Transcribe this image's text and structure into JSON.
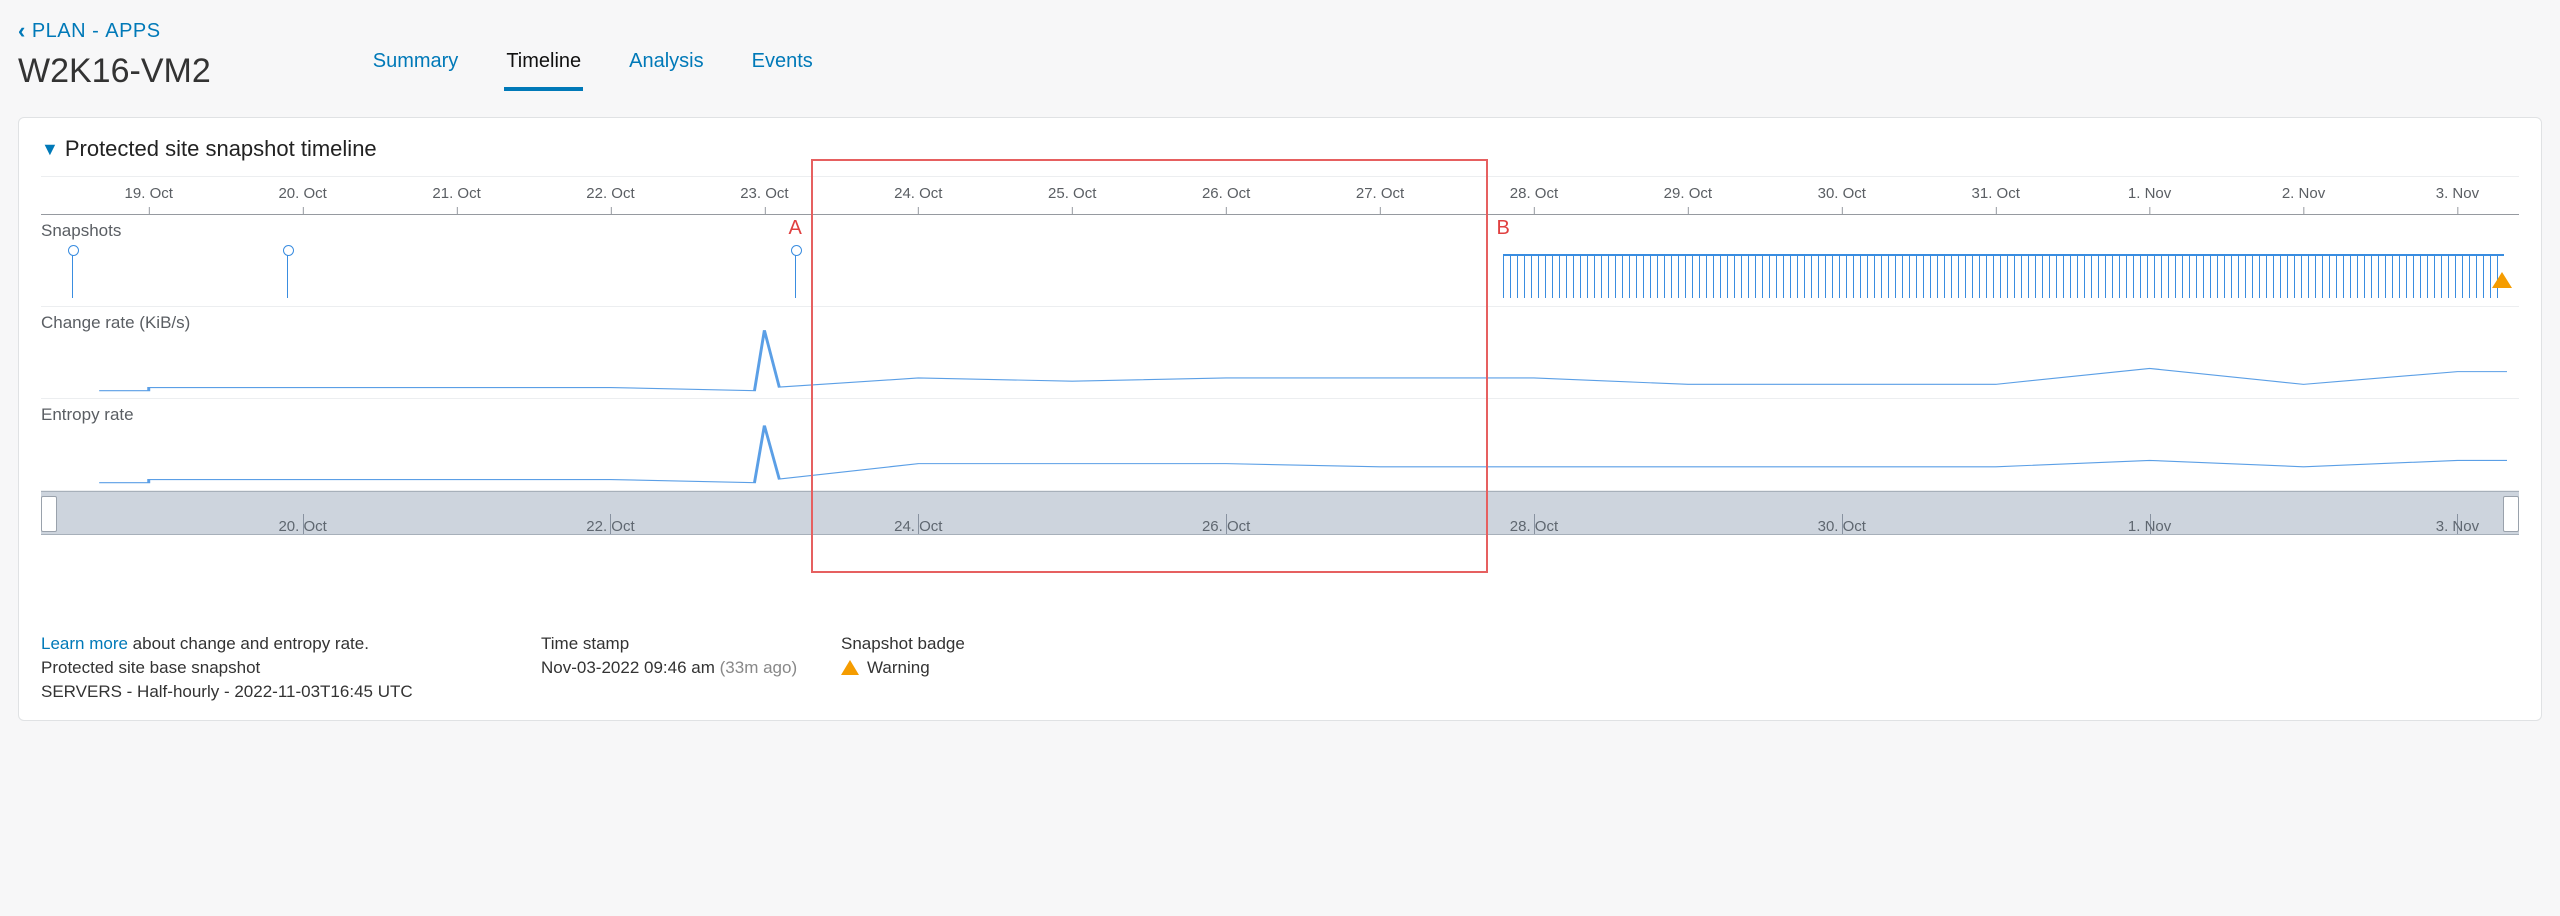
{
  "breadcrumb": {
    "back_label": "PLAN",
    "sep": " - ",
    "section": "APPS"
  },
  "page_title": "W2K16-VM2",
  "tabs": [
    {
      "label": "Summary",
      "active": false
    },
    {
      "label": "Timeline",
      "active": true
    },
    {
      "label": "Analysis",
      "active": false
    },
    {
      "label": "Events",
      "active": false
    }
  ],
  "section": {
    "title": "Protected site snapshot timeline",
    "lanes": {
      "snapshots": "Snapshots",
      "change_rate": "Change rate (KiB/s)",
      "entropy_rate": "Entropy rate"
    }
  },
  "markers": {
    "A": "A",
    "B": "B"
  },
  "footer": {
    "learn_more": "Learn more",
    "learn_more_tail": " about change and entropy rate.",
    "base_label": "Protected site base snapshot",
    "base_value": "SERVERS - Half-hourly - 2022-11-03T16:45 UTC",
    "ts_label": "Time stamp",
    "ts_value": "Nov-03-2022 09:46 am",
    "ts_ago": "(33m ago)",
    "badge_label": "Snapshot badge",
    "badge_value": "Warning"
  },
  "chart_data": {
    "type": "line",
    "categories": [
      "19. Oct",
      "20. Oct",
      "21. Oct",
      "22. Oct",
      "23. Oct",
      "24. Oct",
      "25. Oct",
      "26. Oct",
      "27. Oct",
      "28. Oct",
      "29. Oct",
      "30. Oct",
      "31. Oct",
      "1. Nov",
      "2. Nov",
      "3. Nov"
    ],
    "x_daynum": [
      19,
      20,
      21,
      22,
      23,
      24,
      25,
      26,
      27,
      28,
      29,
      30,
      31,
      32,
      33,
      34
    ],
    "series": [
      {
        "name": "Change rate (KiB/s)",
        "values": [
          0.5,
          0.5,
          0.5,
          0.5,
          9.5,
          2.0,
          1.5,
          2.0,
          2.0,
          2.0,
          1.0,
          1.0,
          1.0,
          3.5,
          1.0,
          3.0
        ],
        "ylim": [
          0,
          10
        ],
        "ylabel": "KiB/s"
      },
      {
        "name": "Entropy rate",
        "values": [
          0.5,
          0.5,
          0.5,
          0.5,
          9.0,
          3.0,
          3.0,
          3.0,
          2.5,
          2.5,
          2.5,
          2.5,
          2.5,
          3.5,
          2.5,
          3.5
        ],
        "ylim": [
          0,
          10
        ],
        "ylabel": ""
      }
    ],
    "snapshots": {
      "sparse_at": [
        18.5,
        19.9,
        23.2
      ],
      "dense_range": [
        27.8,
        34.3
      ]
    },
    "highlight_range": [
      23.3,
      27.7
    ],
    "annotations": [
      {
        "label": "A",
        "x": 23.2
      },
      {
        "label": "B",
        "x": 27.8
      }
    ],
    "scrubber_ticks": [
      "20. Oct",
      "22. Oct",
      "24. Oct",
      "26. Oct",
      "28. Oct",
      "30. Oct",
      "1. Nov",
      "3. Nov"
    ],
    "scrubber_tick_x": [
      20,
      22,
      24,
      26,
      28,
      30,
      32,
      34
    ],
    "xlim_daynum": [
      18.3,
      34.4
    ]
  }
}
